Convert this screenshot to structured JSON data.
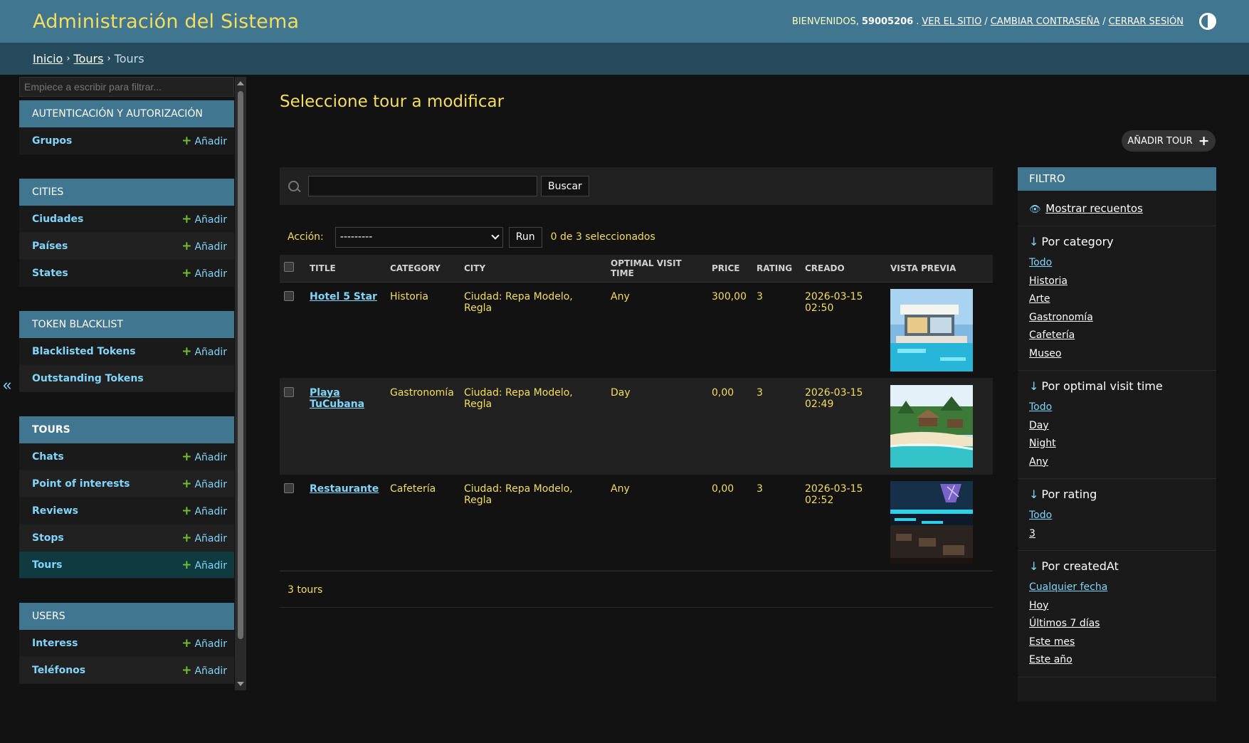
{
  "header": {
    "branding": "Administración del Sistema",
    "welcome": "Bienvenidos,",
    "username": "59005206",
    "view_site": "Ver el sitio",
    "change_password": "Cambiar contraseña",
    "logout": "Cerrar sesión",
    "theme_icon": "half-circle-icon"
  },
  "breadcrumbs": {
    "home": "Inicio",
    "app": "Tours",
    "current": "Tours",
    "separator": "›"
  },
  "sidebar": {
    "filter_placeholder": "Empiece a escribir para filtrar...",
    "toggle": "«",
    "add_label": "Añadir",
    "modules": [
      {
        "caption": "Autenticación y autorización",
        "models": [
          {
            "name": "Grupos",
            "add": true
          }
        ]
      },
      {
        "caption": "Cities",
        "models": [
          {
            "name": "Ciudades",
            "add": true
          },
          {
            "name": "Países",
            "add": true
          },
          {
            "name": "States",
            "add": true
          }
        ]
      },
      {
        "caption": "Token Blacklist",
        "models": [
          {
            "name": "Blacklisted Tokens",
            "add": true
          },
          {
            "name": "Outstanding Tokens",
            "add": false
          }
        ]
      },
      {
        "caption": "Tours",
        "current": true,
        "models": [
          {
            "name": "Chats",
            "add": true
          },
          {
            "name": "Point of interests",
            "add": true
          },
          {
            "name": "Reviews",
            "add": true
          },
          {
            "name": "Stops",
            "add": true
          },
          {
            "name": "Tours",
            "add": true,
            "current": true
          }
        ]
      },
      {
        "caption": "Users",
        "models": [
          {
            "name": "Interess",
            "add": true
          },
          {
            "name": "Teléfonos",
            "add": true
          }
        ]
      }
    ]
  },
  "main": {
    "title": "Seleccione tour a modificar",
    "add_button": "Añadir tour",
    "search_button": "Buscar",
    "action_label": "Acción:",
    "action_selected": "---------",
    "run_button": "Run",
    "selection_count": "0 de 3 seleccionados",
    "columns": [
      "Title",
      "Category",
      "City",
      "Optimal visit time",
      "Price",
      "Rating",
      "Creado",
      "Vista previa"
    ],
    "rows": [
      {
        "title": "Hotel 5 Star",
        "category": "Historia",
        "city": "Ciudad: Repa Modelo, Regla",
        "optimal": "Any",
        "price": "300,00",
        "rating": "3",
        "created": "2026-03-15 02:50",
        "preview": "villa-pool-image"
      },
      {
        "title": "Playa TuCubana",
        "category": "Gastronomía",
        "city": "Ciudad: Repa Modelo, Regla",
        "optimal": "Day",
        "price": "0,00",
        "rating": "3",
        "created": "2026-03-15 02:49",
        "preview": "beach-bungalows-image"
      },
      {
        "title": "Restaurante",
        "category": "Cafetería",
        "city": "Ciudad: Repa Modelo, Regla",
        "optimal": "Any",
        "price": "0,00",
        "rating": "3",
        "created": "2026-03-15 02:52",
        "preview": "restaurant-interior-image"
      }
    ],
    "paginator": "3 tours"
  },
  "filter": {
    "title": "Filtro",
    "show_counts": "Mostrar recuentos",
    "groups": [
      {
        "title": "Por category",
        "choices": [
          "Todo",
          "Historia",
          "Arte",
          "Gastronomía",
          "Cafetería",
          "Museo"
        ]
      },
      {
        "title": "Por optimal visit time",
        "choices": [
          "Todo",
          "Day",
          "Night",
          "Any"
        ]
      },
      {
        "title": "Por rating",
        "choices": [
          "Todo",
          "3"
        ]
      },
      {
        "title": "Por createdAt",
        "choices": [
          "Cualquier fecha",
          "Hoy",
          "Últimos 7 días",
          "Este mes",
          "Este año"
        ]
      }
    ]
  },
  "colors": {
    "header": "#417690",
    "breadcrumbs": "#264b5d",
    "link": "#81d4fa",
    "text": "#f5dd5d",
    "add_plus": "#70bf2b"
  }
}
